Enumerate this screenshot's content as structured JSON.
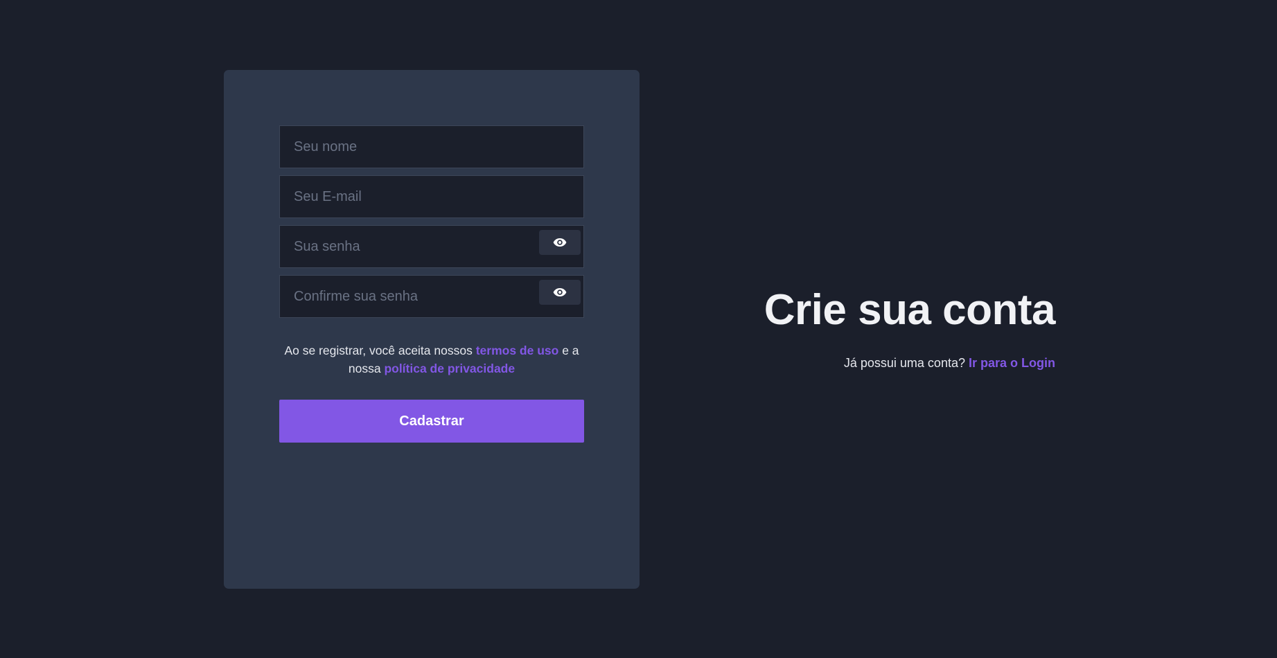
{
  "form": {
    "name_placeholder": "Seu nome",
    "email_placeholder": "Seu E-mail",
    "password_placeholder": "Sua senha",
    "confirm_placeholder": "Confirme sua senha",
    "terms_prefix": "Ao se registrar, você aceita nossos ",
    "terms_link": "termos de uso",
    "terms_middle": " e a nossa ",
    "privacy_link": "política de privacidade",
    "submit_label": "Cadastrar"
  },
  "side": {
    "heading": "Crie sua conta",
    "login_prompt": "Já possui uma conta? ",
    "login_link": "Ir para o Login"
  },
  "icons": {
    "password_toggle": "eye-icon"
  },
  "colors": {
    "background": "#1b1f2b",
    "card": "#2e384b",
    "accent": "#8257e5",
    "text": "#e6e8ee"
  }
}
